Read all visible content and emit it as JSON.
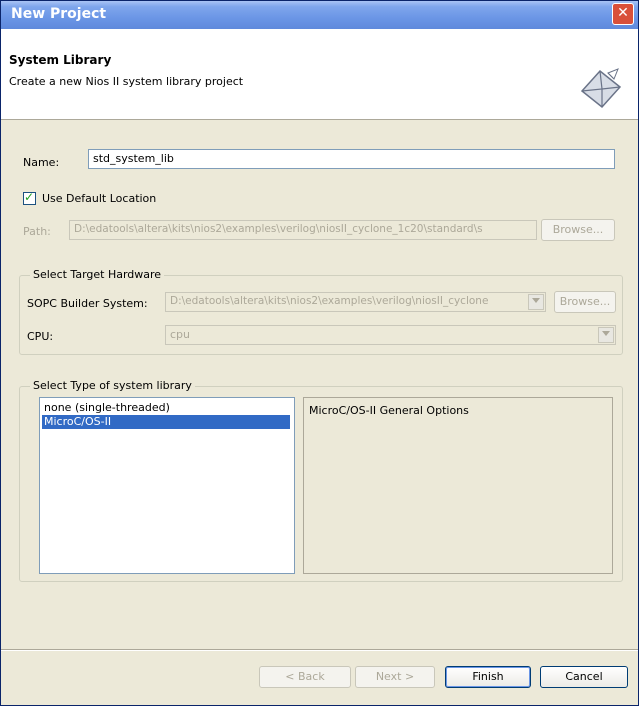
{
  "window": {
    "title": "New Project",
    "close_symbol": "✕"
  },
  "header": {
    "title": "System Library",
    "description": "Create a new Nios II system library project",
    "icon": "wizard-envelope-icon"
  },
  "form": {
    "name_label": "Name:",
    "name_value": "std_system_lib",
    "use_default_label": "Use Default Location",
    "use_default_checked": true,
    "path_label": "Path:",
    "path_value": "D:\\edatools\\altera\\kits\\nios2\\examples\\verilog\\niosII_cyclone_1c20\\standard\\s",
    "browse_label": "Browse..."
  },
  "target_hardware": {
    "legend": "Select Target Hardware",
    "sopc_label": "SOPC Builder System:",
    "sopc_value": "D:\\edatools\\altera\\kits\\nios2\\examples\\verilog\\niosII_cyclone",
    "browse_label": "Browse...",
    "cpu_label": "CPU:",
    "cpu_value": "cpu"
  },
  "system_library": {
    "legend": "Select Type of system library",
    "items": [
      "none (single-threaded)",
      "MicroC/OS-II"
    ],
    "selected_index": 1,
    "options_title": "MicroC/OS-II General Options"
  },
  "buttons": {
    "back": "< Back",
    "next": "Next >",
    "finish": "Finish",
    "cancel": "Cancel"
  },
  "colors": {
    "titlebar": "#6b96e6",
    "selection": "#316ac5",
    "dialog_bg": "#ece9d8"
  }
}
